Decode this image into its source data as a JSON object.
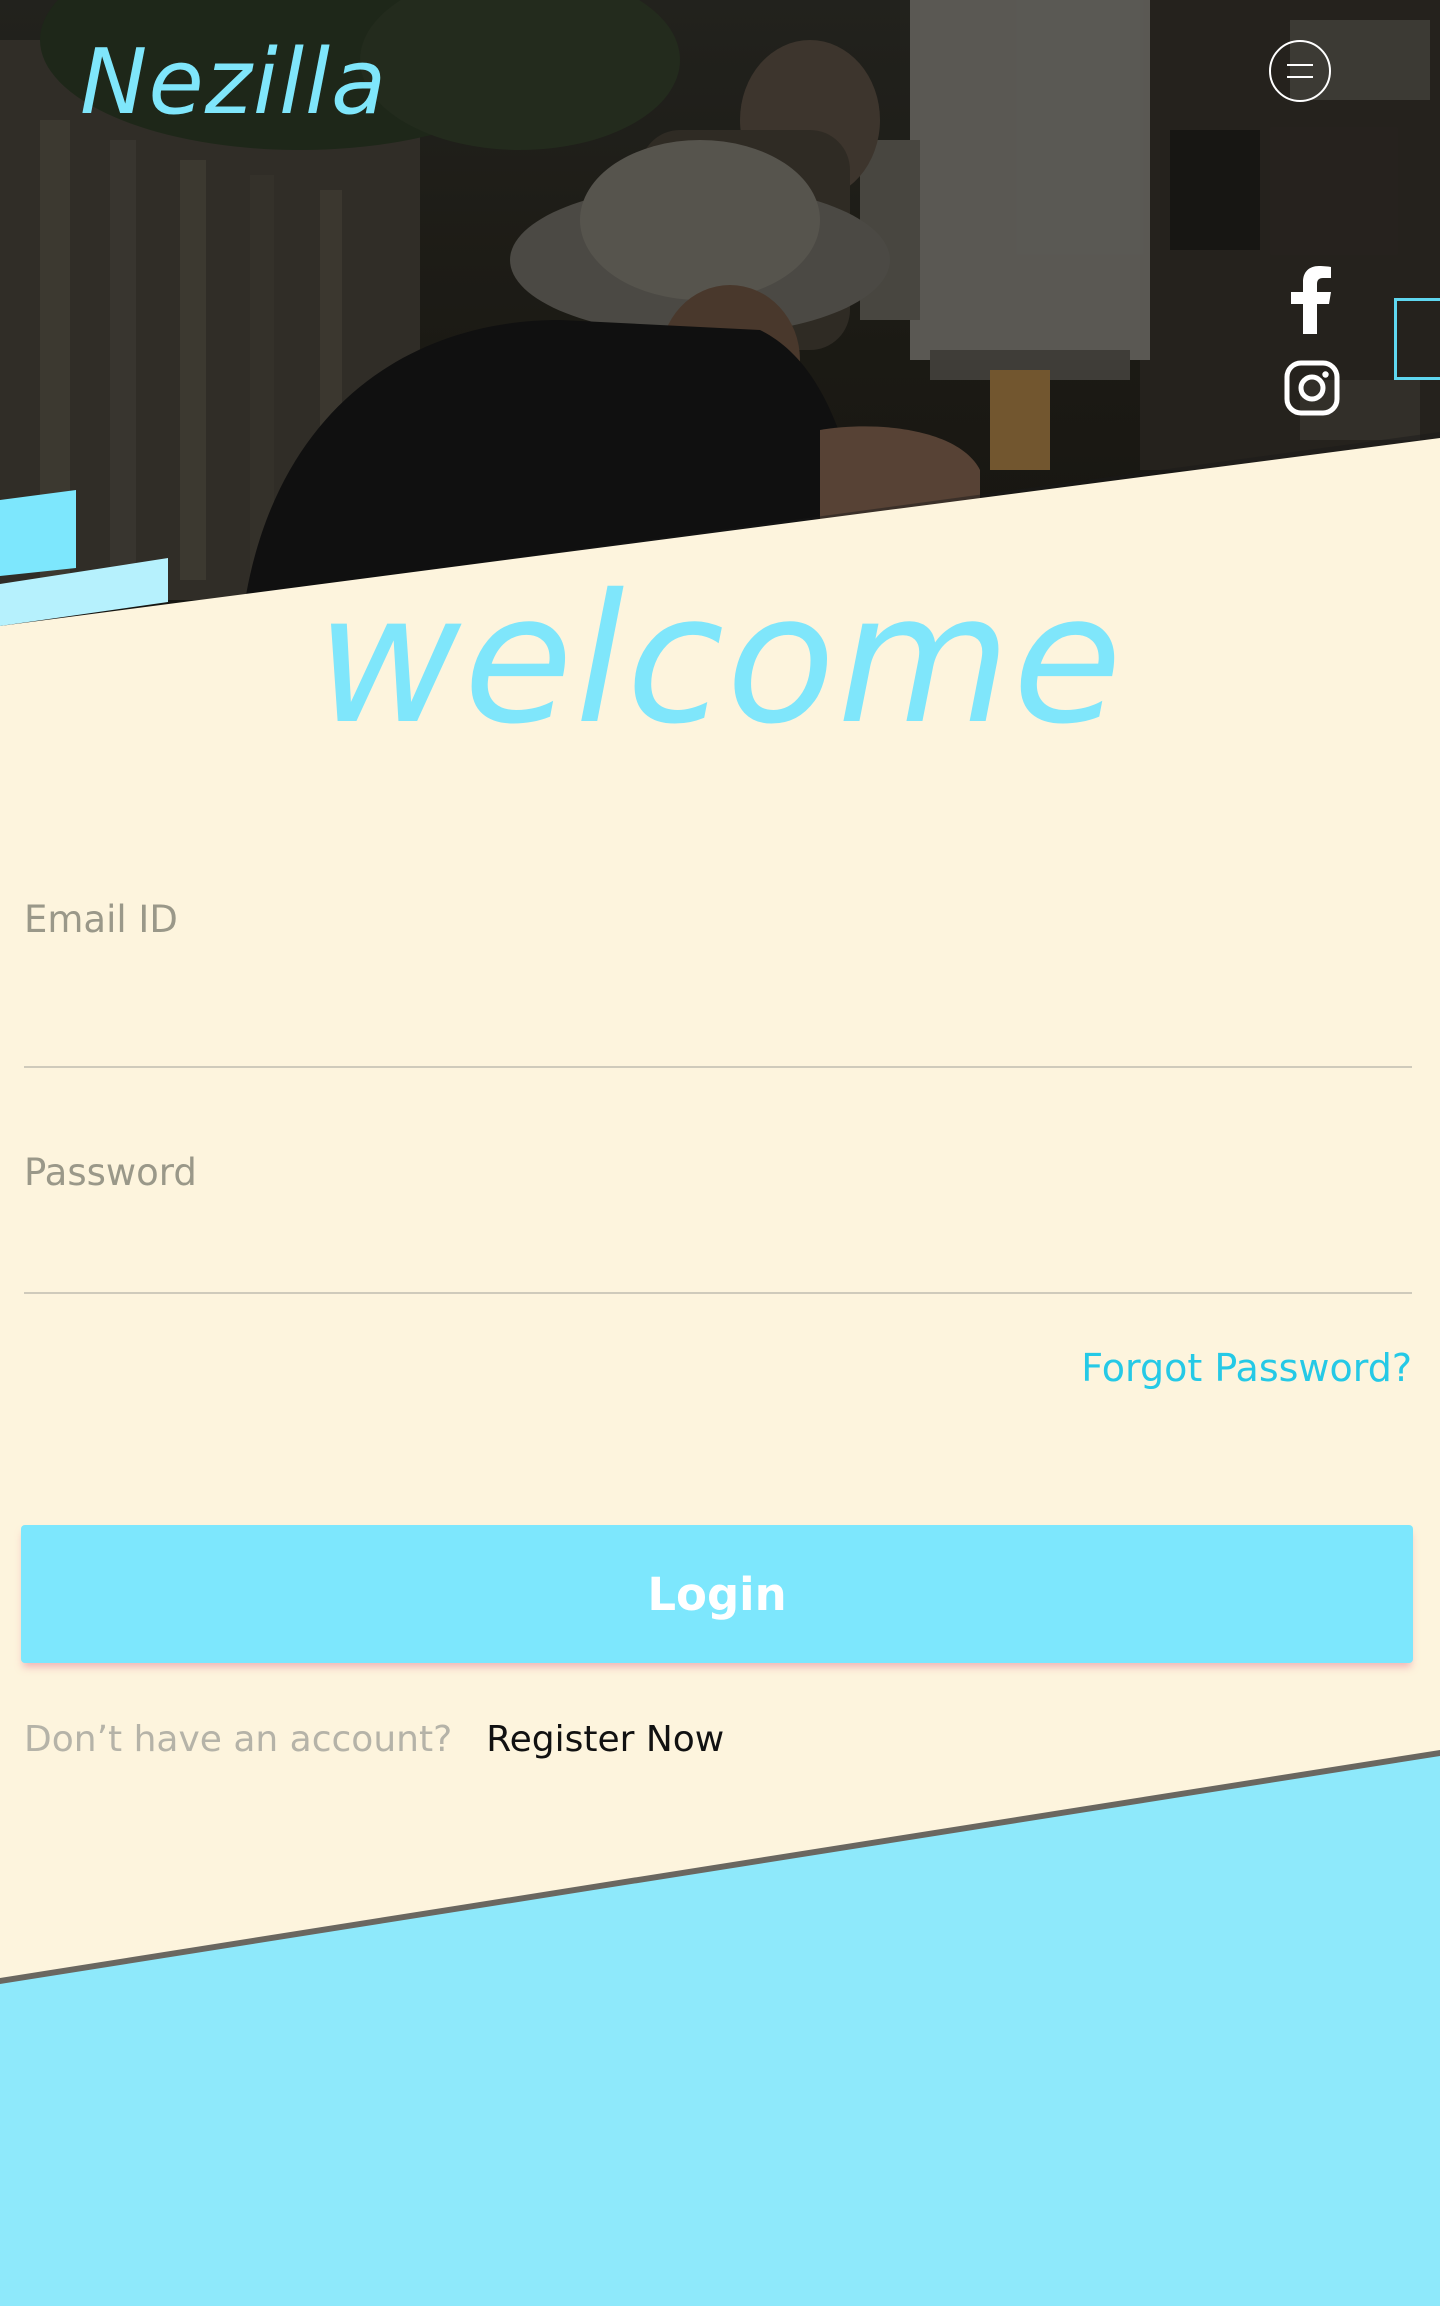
{
  "brand": {
    "logo_text": "Nezilla"
  },
  "header": {
    "menu_icon": "hamburger-menu-icon",
    "social_icons": [
      "facebook-icon",
      "instagram-icon"
    ]
  },
  "form": {
    "heading": "welcome",
    "email_placeholder": "Email ID",
    "email_value": "",
    "password_placeholder": "Password",
    "password_value": "",
    "forgot_label": "Forgot Password?",
    "login_label": "Login",
    "register_prompt": "Don’t have an account?",
    "register_label": "Register Now"
  },
  "colors": {
    "accent_cyan": "#7fe6fb",
    "link_cyan": "#25c9e6",
    "cream_background": "#fdf4dd",
    "bottom_band": "#8ee9fb",
    "hero_dark": "#222019"
  }
}
